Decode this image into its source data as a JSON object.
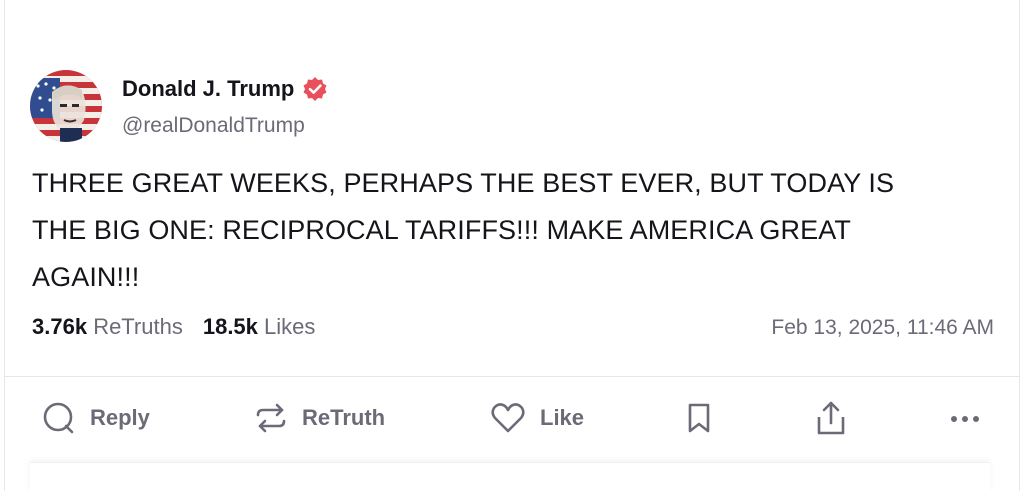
{
  "post": {
    "author_name": "Donald J. Trump",
    "author_handle": "@realDonaldTrump",
    "text_line1": "THREE GREAT WEEKS, PERHAPS THE BEST EVER, BUT TODAY IS",
    "text_line2": "THE BIG ONE: RECIPROCAL TARIFFS!!! MAKE AMERICA GREAT",
    "text_line3": "AGAIN!!!",
    "retruths_count": "3.76k",
    "retruths_label": "ReTruths",
    "likes_count": "18.5k",
    "likes_label": "Likes",
    "timestamp": "Feb 13, 2025, 11:46 AM"
  },
  "actions": {
    "reply_label": "Reply",
    "retruth_label": "ReTruth",
    "like_label": "Like"
  },
  "colors": {
    "verified_badge": "#e8505b",
    "muted_text": "#6b6b78",
    "primary_text": "#14141a"
  },
  "icons": [
    "verified-badge-icon",
    "reply-icon",
    "retruth-icon",
    "like-icon",
    "bookmark-icon",
    "share-icon",
    "more-icon"
  ]
}
